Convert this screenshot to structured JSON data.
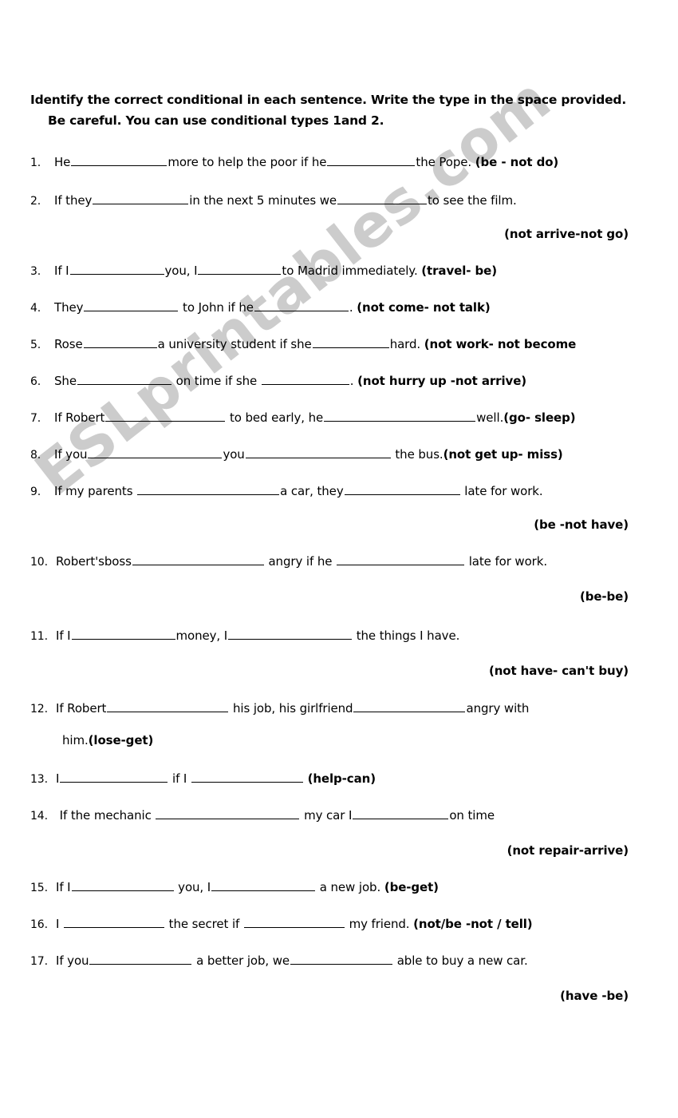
{
  "document": {
    "title": "Conditionals worksheet",
    "watermark": "ESLprintables.com",
    "watermark_color": "#cccccc"
  },
  "instructions": {
    "line1": "Identify the correct conditional in each sentence. Write the type in the space provided.",
    "line2": "Be careful. You can use conditional types  1and 2."
  },
  "exercises": [
    {
      "number": "1.",
      "pre": "He",
      "mid": "more to help the poor if he",
      "post": "the Pope.",
      "cue": "(be - not do)",
      "blank1_width": 120,
      "blank2_width": 110
    },
    {
      "number": "2.",
      "pre": "If they",
      "mid": "in the next 5 minutes we",
      "post": "to see the film.",
      "cue_below": "(not arrive-not go)",
      "blank1_width": 120,
      "blank2_width": 112
    },
    {
      "number": "3.",
      "pre": "If  I",
      "mid": "you, I",
      "post": "to Madrid immediately.",
      "cue": "(travel- be)",
      "blank1_width": 118,
      "blank2_width": 104
    },
    {
      "number": "4.",
      "pre": "They",
      "mid": "to John if he",
      "post": ".",
      "cue": "(not come- not talk)",
      "blank1_width": 118,
      "blank2_width": 118
    },
    {
      "number": "5.",
      "pre": "Rose",
      "mid": "a university student if she",
      "post": "hard.",
      "cue": "(not work- not become",
      "blank1_width": 92,
      "blank2_width": 96
    },
    {
      "number": "6.",
      "pre": "She",
      "mid": "on time if she",
      "post": ".",
      "cue": "(not hurry up -not arrive)",
      "blank1_width": 118,
      "blank2_width": 110
    },
    {
      "number": "7.",
      "pre": "If Robert",
      "mid": "to bed early, he",
      "post": "well.",
      "cue": "(go- sleep)",
      "blank1_width": 150,
      "blank2_width": 190
    },
    {
      "number": "8.",
      "pre": "If you",
      "mid": "you",
      "post": "the bus.",
      "cue": "(not get up- miss)",
      "blank1_width": 168,
      "blank2_width": 182
    },
    {
      "number": "9.",
      "pre": "If  my parents",
      "mid": "a car, they",
      "post": "late for work.",
      "cue_below": "(be -not have)",
      "blank1_width": 178,
      "blank2_width": 145
    },
    {
      "number": "10.",
      "pre": "Robert'sboss",
      "mid": "angry if he",
      "post": "late for work.",
      "cue_below": "(be-be)",
      "blank1_width": 165,
      "blank2_width": 160
    },
    {
      "number": "11.",
      "pre": "If  I",
      "mid": "money, I",
      "post": "the things I have.",
      "cue_below": "(not have- can't buy)",
      "blank1_width": 130,
      "blank2_width": 155
    },
    {
      "number": "12.",
      "pre": "If Robert",
      "mid": "his job, his girlfriend",
      "post": "angry with",
      "continuation": "him.",
      "cue_inline": "(lose-get)",
      "blank1_width": 152,
      "blank2_width": 140
    },
    {
      "number": "13.",
      "pre": "I",
      "mid": "if I",
      "post": "",
      "cue": "(help-can)",
      "blank1_width": 135,
      "blank2_width": 140
    },
    {
      "number": "14.",
      "pre": " If the mechanic",
      "mid": "my car I",
      "post": "on time",
      "cue_below": "(not repair-arrive)",
      "blank1_width": 180,
      "blank2_width": 120
    },
    {
      "number": "15.",
      "pre": "If I",
      "mid": "you, I",
      "post": "a new job.",
      "cue": "(be-get)",
      "blank1_width": 128,
      "blank2_width": 130
    },
    {
      "number": "16.",
      "pre": "I",
      "mid": "the secret  if",
      "post": "my friend.",
      "cue": "(not/be -not / tell)",
      "blank1_width": 126,
      "blank2_width": 126
    },
    {
      "number": "17.",
      "pre": "If you",
      "mid": "a better job, we",
      "post": "able to buy a new car.",
      "cue_below": "(have -be)",
      "blank1_width": 128,
      "blank2_width": 128
    }
  ]
}
